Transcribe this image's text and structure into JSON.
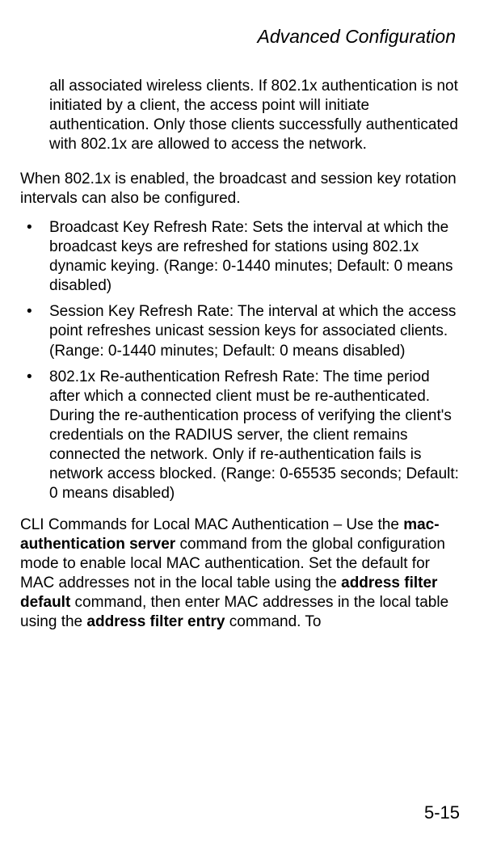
{
  "header": {
    "title": "Advanced Configuration"
  },
  "content": {
    "intro_para": "all associated wireless clients. If 802.1x authentication is not initiated by a client, the access point will initiate authentication. Only those clients successfully authenticated with 802.1x are allowed to access the network.",
    "para2": "When 802.1x is enabled, the broadcast and session key rotation intervals can also be configured.",
    "bullets": [
      "Broadcast Key Refresh Rate: Sets the interval at which the broadcast keys are refreshed for stations using 802.1x dynamic keying. (Range: 0-1440 minutes; Default: 0 means disabled)",
      "Session Key Refresh Rate: The interval at which the access point refreshes unicast session keys for associated clients. (Range: 0-1440 minutes; Default: 0 means disabled)",
      "802.1x Re-authentication Refresh Rate: The time period after which a connected client must be re-authenticated. During the re-authentication process of verifying the client's credentials on the RADIUS server, the client remains connected the network. Only if re-authentication fails is network access blocked. (Range: 0-65535 seconds; Default: 0 means disabled)"
    ],
    "cli_para_part1": "CLI Commands for Local MAC Authentication – Use the ",
    "cli_bold1": "mac-authentication server",
    "cli_para_part2": " command from the global configuration mode to enable local MAC authentication. Set the default for MAC addresses not in the local table using the ",
    "cli_bold2": "address filter default",
    "cli_para_part3": " command, then enter MAC addresses in the local table using the ",
    "cli_bold3": "address filter entry",
    "cli_para_part4": " command. To"
  },
  "page_number": "5-15"
}
